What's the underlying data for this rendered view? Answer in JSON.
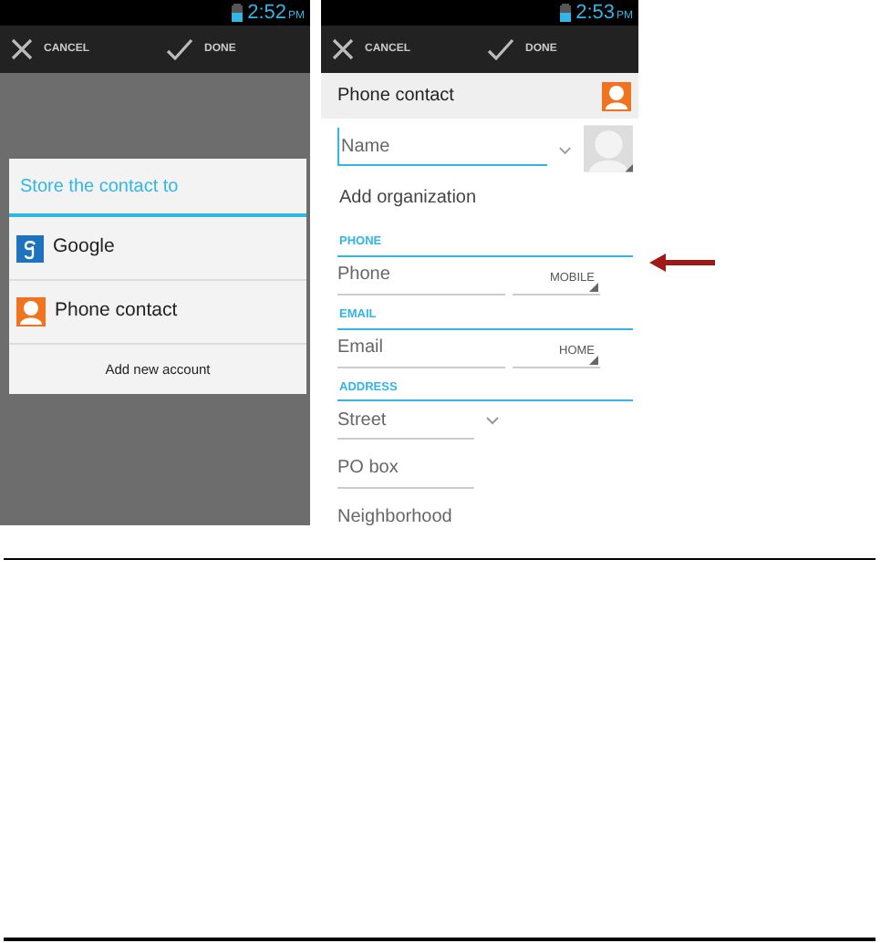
{
  "screens": [
    {
      "status_bar": {
        "time": "2:52",
        "meridiem": "PM"
      },
      "action_bar": [
        {
          "kind": "cancel",
          "label": "CANCEL"
        },
        {
          "kind": "done",
          "label": "DONE"
        }
      ],
      "dialog": {
        "title": "Store the contact to",
        "options": [
          {
            "kind": "google",
            "label": "Google"
          },
          {
            "kind": "phone",
            "label": "Phone contact"
          }
        ],
        "footer": "Add new account"
      }
    },
    {
      "status_bar": {
        "time": "2:53",
        "meridiem": "PM"
      },
      "action_bar": [
        {
          "kind": "cancel",
          "label": "CANCEL"
        },
        {
          "kind": "done",
          "label": "DONE"
        }
      ],
      "account": {
        "label": "Phone contact"
      },
      "form": [
        {
          "kind": "name",
          "placeholder": "Name",
          "focused": true
        },
        {
          "kind": "link",
          "label": "Add organization"
        },
        {
          "kind": "section",
          "label": "PHONE"
        },
        {
          "kind": "typed",
          "placeholder": "Phone",
          "type": "MOBILE"
        },
        {
          "kind": "section",
          "label": "EMAIL"
        },
        {
          "kind": "typed",
          "placeholder": "Email",
          "type": "HOME"
        },
        {
          "kind": "section",
          "label": "ADDRESS"
        },
        {
          "kind": "expand",
          "placeholder": "Street"
        },
        {
          "kind": "field",
          "placeholder": "PO box"
        },
        {
          "kind": "field",
          "placeholder": "Neighborhood"
        }
      ]
    }
  ]
}
